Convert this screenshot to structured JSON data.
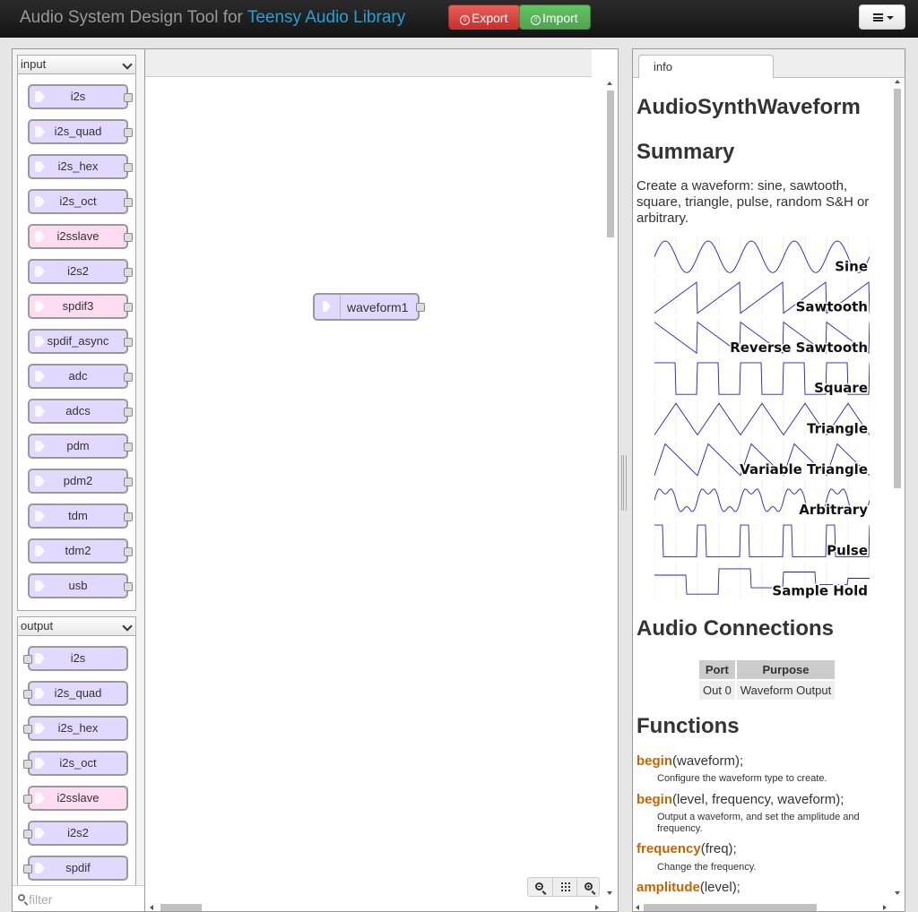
{
  "header": {
    "title_prefix": "Audio System Design Tool for ",
    "title_link": "Teensy Audio Library",
    "export_label": "Export",
    "import_label": "Import"
  },
  "palette": {
    "input": {
      "label": "input",
      "nodes": [
        {
          "label": "i2s",
          "pink": false
        },
        {
          "label": "i2s_quad",
          "pink": false
        },
        {
          "label": "i2s_hex",
          "pink": false
        },
        {
          "label": "i2s_oct",
          "pink": false
        },
        {
          "label": "i2sslave",
          "pink": true
        },
        {
          "label": "i2s2",
          "pink": false
        },
        {
          "label": "spdif3",
          "pink": true
        },
        {
          "label": "spdif_async",
          "pink": false
        },
        {
          "label": "adc",
          "pink": false
        },
        {
          "label": "adcs",
          "pink": false
        },
        {
          "label": "pdm",
          "pink": false
        },
        {
          "label": "pdm2",
          "pink": false
        },
        {
          "label": "tdm",
          "pink": false
        },
        {
          "label": "tdm2",
          "pink": false
        },
        {
          "label": "usb",
          "pink": false
        }
      ]
    },
    "output": {
      "label": "output",
      "nodes": [
        {
          "label": "i2s",
          "pink": false
        },
        {
          "label": "i2s_quad",
          "pink": false
        },
        {
          "label": "i2s_hex",
          "pink": false
        },
        {
          "label": "i2s_oct",
          "pink": false
        },
        {
          "label": "i2sslave",
          "pink": true
        },
        {
          "label": "i2s2",
          "pink": false
        },
        {
          "label": "spdif",
          "pink": false
        }
      ]
    },
    "filter_placeholder": "filter"
  },
  "workspace": {
    "node_label": "waveform1"
  },
  "info": {
    "tab_label": "info",
    "title": "AudioSynthWaveform",
    "summary_heading": "Summary",
    "summary_text": "Create a waveform: sine, sawtooth, square, triangle, pulse, random S&H or arbitrary.",
    "waveforms": [
      "Sine",
      "Sawtooth",
      "Reverse Sawtooth",
      "Square",
      "Triangle",
      "Variable Triangle",
      "Arbitrary",
      "Pulse",
      "Sample Hold"
    ],
    "connections_heading": "Audio Connections",
    "connections_headers": [
      "Port",
      "Purpose"
    ],
    "connections_rows": [
      [
        "Out 0",
        "Waveform Output"
      ]
    ],
    "functions_heading": "Functions",
    "functions": [
      {
        "name": "begin",
        "args": "(waveform);",
        "desc": "Configure the waveform type to create."
      },
      {
        "name": "begin",
        "args": "(level, frequency, waveform);",
        "desc": "Output a waveform, and set the amplitude and frequency."
      },
      {
        "name": "frequency",
        "args": "(freq);",
        "desc": "Change the frequency."
      },
      {
        "name": "amplitude",
        "args": "(level);",
        "desc": ""
      }
    ]
  }
}
